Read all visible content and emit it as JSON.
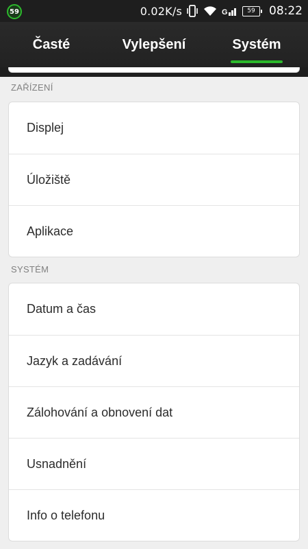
{
  "status_bar": {
    "notification_badge": "59",
    "network_speed": "0.02K/s",
    "battery_level": "59",
    "time": "08:22",
    "icons": [
      "vibrate-icon",
      "wifi-icon",
      "signal-icon",
      "battery-icon"
    ]
  },
  "tabs": [
    {
      "label": "Časté",
      "active": false
    },
    {
      "label": "Vylepšení",
      "active": false
    },
    {
      "label": "Systém",
      "active": true
    }
  ],
  "accent_color": "#2db92d",
  "sections": [
    {
      "header": "ZAŘÍZENÍ",
      "items": [
        "Displej",
        "Úložiště",
        "Aplikace"
      ]
    },
    {
      "header": "SYSTÉM",
      "items": [
        "Datum a čas",
        "Jazyk a zadávání",
        "Zálohování a obnovení dat",
        "Usnadnění",
        "Info o telefonu"
      ]
    }
  ]
}
